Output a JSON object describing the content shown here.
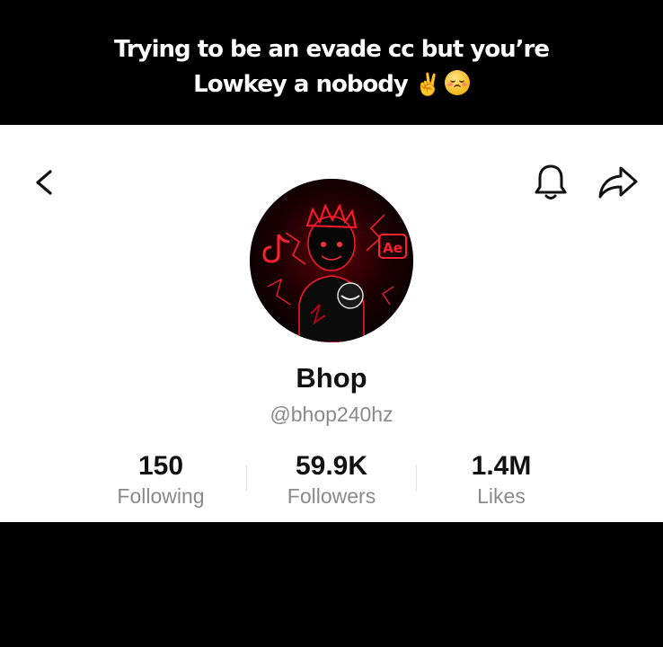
{
  "caption": {
    "line1": "Trying to be an evade cc but you’re",
    "line2": "Lowkey a nobody",
    "emoji_1": "✌️",
    "emoji_2_icon": "flushed-face-emoji"
  },
  "header": {
    "back_icon": "chevron-left-icon",
    "bell_icon": "bell-icon",
    "share_icon": "share-arrow-icon"
  },
  "profile": {
    "avatar_icon": "profile-avatar",
    "avatar_badge_text": "Ae",
    "name": "Bhop",
    "handle": "@bhop240hz"
  },
  "stats": [
    {
      "value": "150",
      "label": "Following"
    },
    {
      "value": "59.9K",
      "label": "Followers"
    },
    {
      "value": "1.4M",
      "label": "Likes"
    }
  ],
  "colors": {
    "caption_bg": "#000000",
    "panel_bg": "#ffffff",
    "secondary_text": "#8a8a8a",
    "avatar_accent": "#e0101e"
  }
}
